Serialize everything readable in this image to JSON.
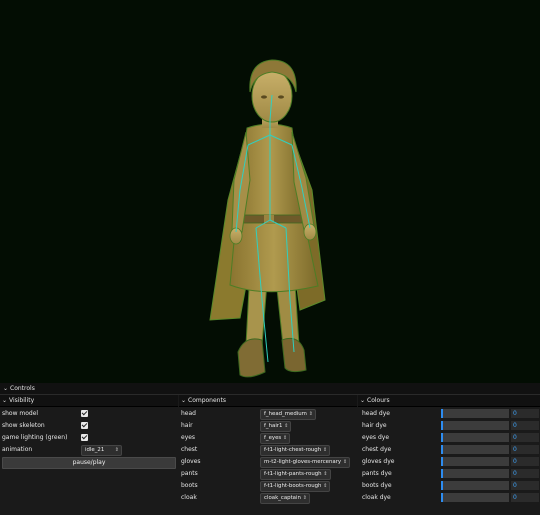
{
  "controls": {
    "title": "Controls"
  },
  "visibility": {
    "title": "Visibility",
    "show_model": "show model",
    "show_skeleton": "show skeleton",
    "game_lighting": "game lighting (green)",
    "animation_label": "animation",
    "animation_value": "idle_21",
    "pause_play": "pause/play"
  },
  "components": {
    "title": "Components",
    "items": [
      {
        "label": "head",
        "value": "f_head_medium"
      },
      {
        "label": "hair",
        "value": "f_hair1"
      },
      {
        "label": "eyes",
        "value": "f_eyes"
      },
      {
        "label": "chest",
        "value": "f-t1-light-chest-rough"
      },
      {
        "label": "gloves",
        "value": "m-t2-light-gloves-mercenary"
      },
      {
        "label": "pants",
        "value": "f-t1-light-pants-rough"
      },
      {
        "label": "boots",
        "value": "f-t1-light-boots-rough"
      },
      {
        "label": "cloak",
        "value": "cloak_captain"
      }
    ]
  },
  "colours": {
    "title": "Colours",
    "items": [
      {
        "label": "head dye",
        "value": "0"
      },
      {
        "label": "hair dye",
        "value": "0"
      },
      {
        "label": "eyes dye",
        "value": "0"
      },
      {
        "label": "chest dye",
        "value": "0"
      },
      {
        "label": "gloves dye",
        "value": "0"
      },
      {
        "label": "pants dye",
        "value": "0"
      },
      {
        "label": "boots dye",
        "value": "0"
      },
      {
        "label": "cloak dye",
        "value": "0"
      }
    ]
  },
  "theme": {
    "viewport_bg": "#030d03",
    "panel_bg": "#1a1a1a",
    "accent": "#2d8cf0",
    "skeleton": "#30d0c0"
  }
}
